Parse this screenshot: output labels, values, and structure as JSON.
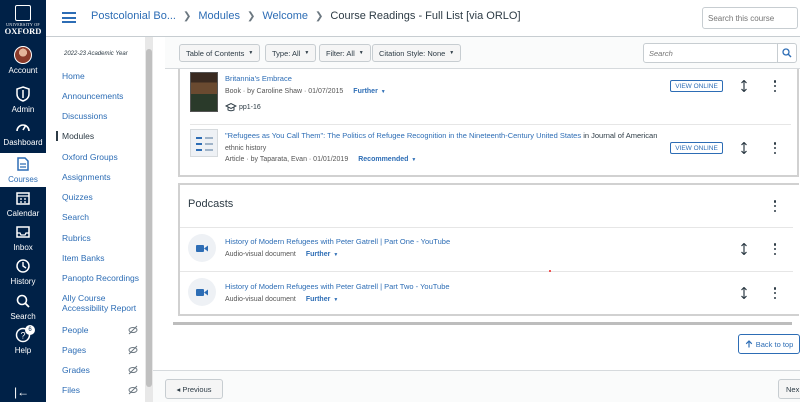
{
  "global_nav": {
    "logo_line1": "UNIVERSITY OF",
    "logo_line2": "OXFORD",
    "items": [
      {
        "label": "Account",
        "icon": "avatar"
      },
      {
        "label": "Admin",
        "icon": "shield-icon"
      },
      {
        "label": "Dashboard",
        "icon": "speedometer-icon"
      },
      {
        "label": "Courses",
        "icon": "book-icon"
      },
      {
        "label": "Calendar",
        "icon": "calendar-icon"
      },
      {
        "label": "Inbox",
        "icon": "inbox-icon"
      },
      {
        "label": "History",
        "icon": "clock-icon"
      },
      {
        "label": "Search",
        "icon": "search-icon"
      },
      {
        "label": "Help",
        "icon": "help-icon",
        "badge": "6"
      }
    ],
    "collapse": "|←"
  },
  "header": {
    "breadcrumbs": [
      "Postcolonial Bo...",
      "Modules",
      "Welcome"
    ],
    "current": "Course Readings - Full List [via ORLO]",
    "search_placeholder": "Search this course"
  },
  "course_nav": {
    "term": "2022-23 Academic Year",
    "items": [
      {
        "label": "Home"
      },
      {
        "label": "Announcements"
      },
      {
        "label": "Discussions"
      },
      {
        "label": "Modules"
      },
      {
        "label": "Oxford Groups"
      },
      {
        "label": "Assignments"
      },
      {
        "label": "Quizzes"
      },
      {
        "label": "Search"
      },
      {
        "label": "Rubrics"
      },
      {
        "label": "Item Banks"
      },
      {
        "label": "Panopto Recordings"
      },
      {
        "label": "Ally Course Accessibility Report"
      },
      {
        "label": "People"
      },
      {
        "label": "Pages"
      },
      {
        "label": "Grades"
      },
      {
        "label": "Files"
      }
    ]
  },
  "toolbar": {
    "toc": "Table of Contents",
    "type": "Type: All",
    "filter": "Filter: All",
    "citation": "Citation Style: None",
    "search_placeholder": "Search"
  },
  "readings": [
    {
      "title": "Britannia's Embrace",
      "meta": "Book   ·   by Caroline Shaw   ·   01/07/2015",
      "tag": "Further",
      "pages": "pp1-16",
      "view": "VIEW ONLINE"
    },
    {
      "title": "\"Refugees as You Call Them\": The Politics of Refugee Recognition in the Nineteenth-Century United States",
      "journal": "in Journal of American",
      "subtitle": "ethnic history",
      "meta": "Article   ·   by Taparata, Evan   ·   01/01/2019",
      "tag": "Recommended",
      "view": "VIEW ONLINE"
    }
  ],
  "podcasts": {
    "heading": "Podcasts",
    "items": [
      {
        "title": "History of Modern Refugees with Peter Gatrell | Part One - YouTube",
        "meta": "Audio-visual document",
        "tag": "Further"
      },
      {
        "title": "History of Modern Refugees with Peter Gatrell | Part Two - YouTube",
        "meta": "Audio-visual document",
        "tag": "Further"
      }
    ]
  },
  "back_to_top": "Back to top",
  "footer": {
    "previous": "◂ Previous",
    "next": "Nex"
  }
}
